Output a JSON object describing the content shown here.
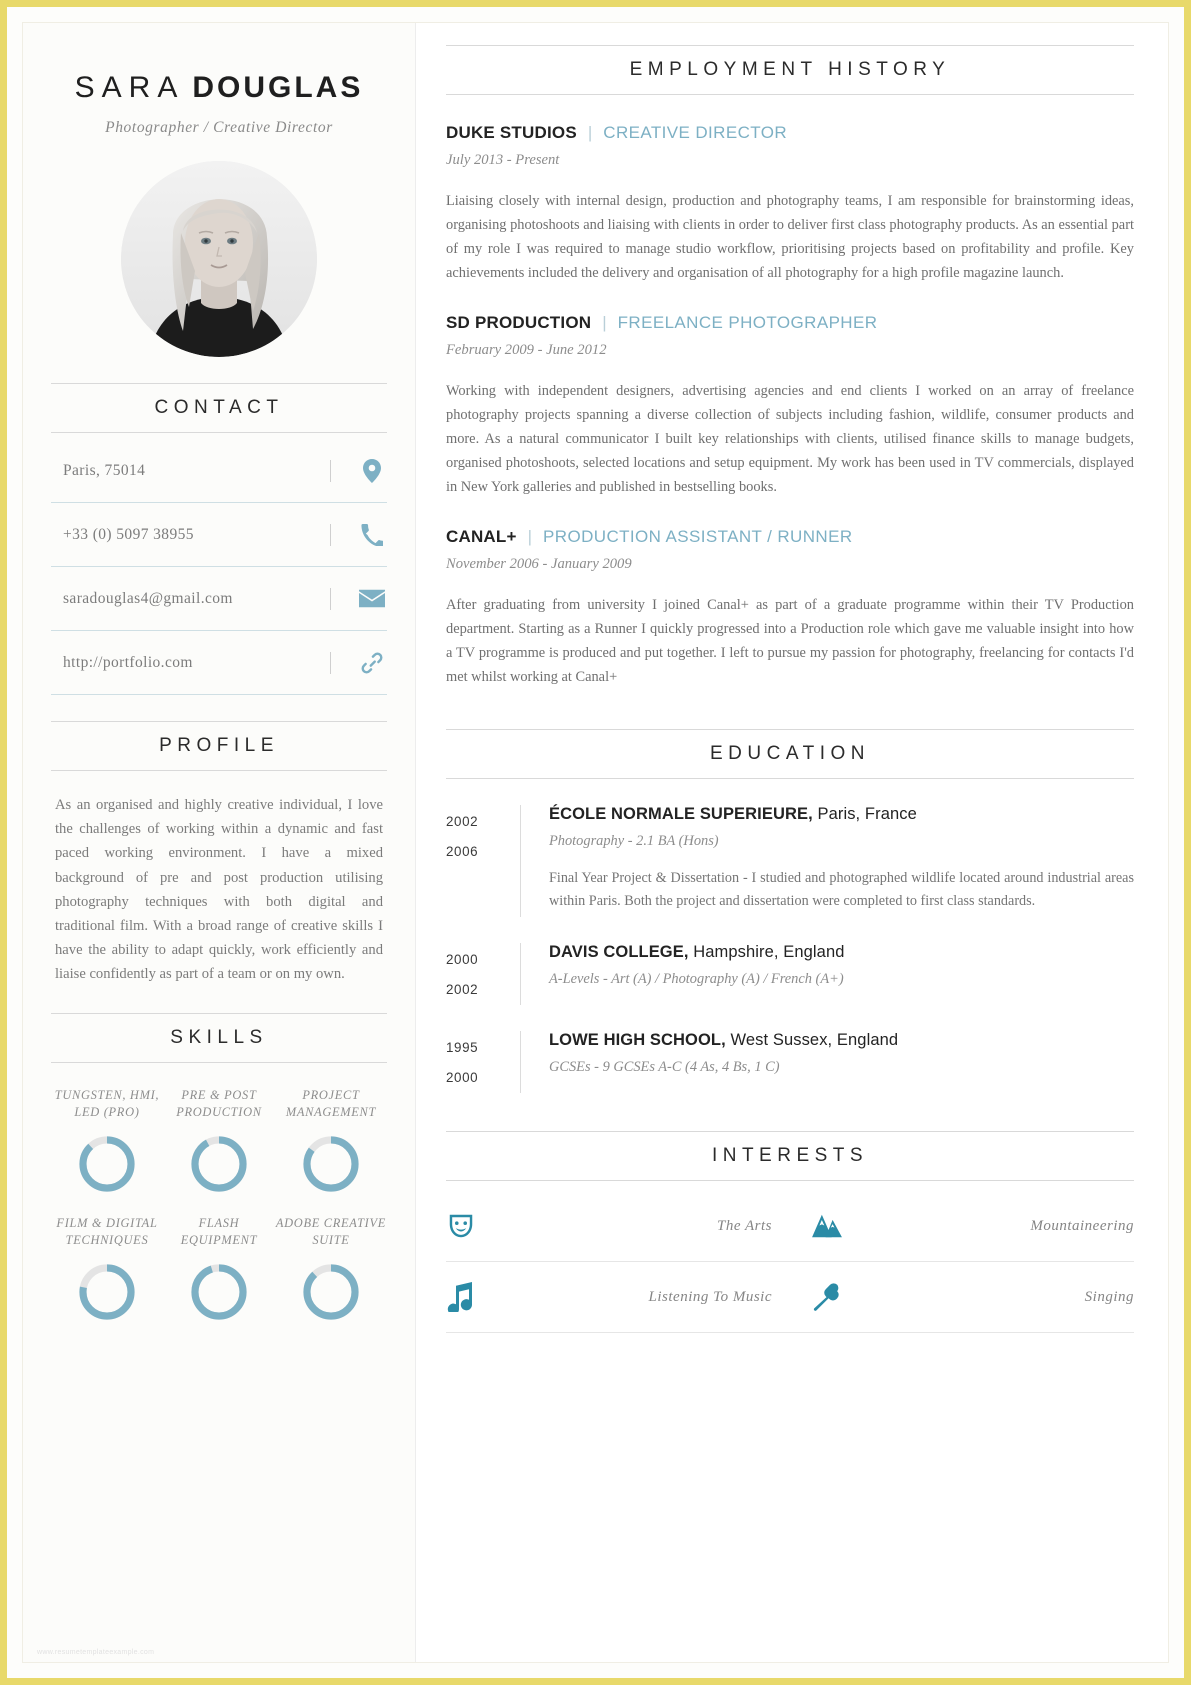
{
  "header": {
    "first_name": "SARA",
    "last_name": "DOUGLAS",
    "tagline": "Photographer / Creative Director"
  },
  "contact": {
    "title": "CONTACT",
    "items": [
      {
        "text": "Paris, 75014",
        "icon": "location-pin-icon"
      },
      {
        "text": "+33 (0) 5097 38955",
        "icon": "phone-icon"
      },
      {
        "text": "saradouglas4@gmail.com",
        "icon": "envelope-icon"
      },
      {
        "text": "http://portfolio.com",
        "icon": "link-icon"
      }
    ]
  },
  "profile": {
    "title": "PROFILE",
    "body": "As an organised and highly creative individual, I love the challenges of working within a dynamic and fast paced working environment. I have a mixed background of pre and post production utilising photography techniques with both digital and traditional film. With a broad range of creative skills I have the ability to adapt quickly, work efficiently and liaise confidently as part of a team or on my own."
  },
  "skills": {
    "title": "SKILLS",
    "items": [
      {
        "label": "TUNGSTEN, HMI, LED (PRO)",
        "percent": 88
      },
      {
        "label": "PRE & POST PRODUCTION",
        "percent": 92
      },
      {
        "label": "PROJECT MANAGEMENT",
        "percent": 85
      },
      {
        "label": "FILM & DIGITAL TECHNIQUES",
        "percent": 78
      },
      {
        "label": "FLASH EQUIPMENT",
        "percent": 95
      },
      {
        "label": "ADOBE CREATIVE SUITE",
        "percent": 88
      }
    ]
  },
  "employment": {
    "title": "EMPLOYMENT HISTORY",
    "jobs": [
      {
        "company": "DUKE STUDIOS",
        "separator": "|",
        "role": "CREATIVE DIRECTOR",
        "dates": "July 2013 - Present",
        "description": "Liaising closely with internal design, production and photography teams, I am responsible for brainstorming ideas, organising photoshoots and liaising with clients in order to deliver first class photography products.   As an essential part of my role I was required to manage studio workflow, prioritising projects based on profitability and profile.  Key achievements included the delivery and organisation of all photography for a high profile magazine launch."
      },
      {
        "company": "SD PRODUCTION",
        "separator": "|",
        "role": "FREELANCE PHOTOGRAPHER",
        "dates": "February 2009 - June 2012",
        "description": "Working with independent designers, advertising agencies and end clients I worked on an array of freelance photography projects spanning a diverse collection of subjects including fashion, wildlife, consumer products and more.  As a natural communicator I built key relationships with clients, utilised finance skills to manage budgets, organised photoshoots, selected locations and setup equipment.   My work has been used in TV commercials, displayed in New York galleries and published in bestselling books."
      },
      {
        "company": "CANAL+",
        "separator": "|",
        "role": "PRODUCTION ASSISTANT / RUNNER",
        "dates": "November 2006 - January 2009",
        "description": "After graduating from university I joined Canal+ as part of a graduate programme within their TV Production department.  Starting as a Runner I quickly progressed into a Production role which gave me valuable insight into how a TV programme is produced and put together. I left to pursue my passion for photography, freelancing for contacts I'd met whilst working at Canal+"
      }
    ]
  },
  "education": {
    "title": "EDUCATION",
    "entries": [
      {
        "year_start": "2002",
        "year_end": "2006",
        "institution": "ÉCOLE NORMALE SUPERIEURE,",
        "location": " Paris, France",
        "qualification": "Photography - 2.1 BA (Hons)",
        "note": "Final Year Project & Dissertation - I studied and photographed wildlife located around industrial areas within Paris. Both the project and dissertation were completed to first class standards."
      },
      {
        "year_start": "2000",
        "year_end": "2002",
        "institution": "DAVIS COLLEGE,",
        "location": " Hampshire, England",
        "qualification": "A-Levels - Art (A) / Photography (A) / French (A+)",
        "note": ""
      },
      {
        "year_start": "1995",
        "year_end": "2000",
        "institution": "LOWE HIGH SCHOOL,",
        "location": " West Sussex, England",
        "qualification": "GCSEs - 9 GCSEs A-C (4 As, 4 Bs, 1 C)",
        "note": ""
      }
    ]
  },
  "interests": {
    "title": "INTERESTS",
    "items": [
      {
        "label": "The Arts",
        "icon": "theater-mask-icon"
      },
      {
        "label": "Mountaineering",
        "icon": "mountains-icon"
      },
      {
        "label": "Listening To Music",
        "icon": "music-note-icon"
      },
      {
        "label": "Singing",
        "icon": "microphone-icon"
      }
    ]
  },
  "colors": {
    "accent": "#7db0c4",
    "icon_teal": "#2a8ba6",
    "heading": "#2b2b2b",
    "body_text": "#6f6f6f",
    "ring_track": "#e4e4e4",
    "border_frame": "#e8d96a"
  },
  "watermark": "www.resumetemplateexample.com"
}
